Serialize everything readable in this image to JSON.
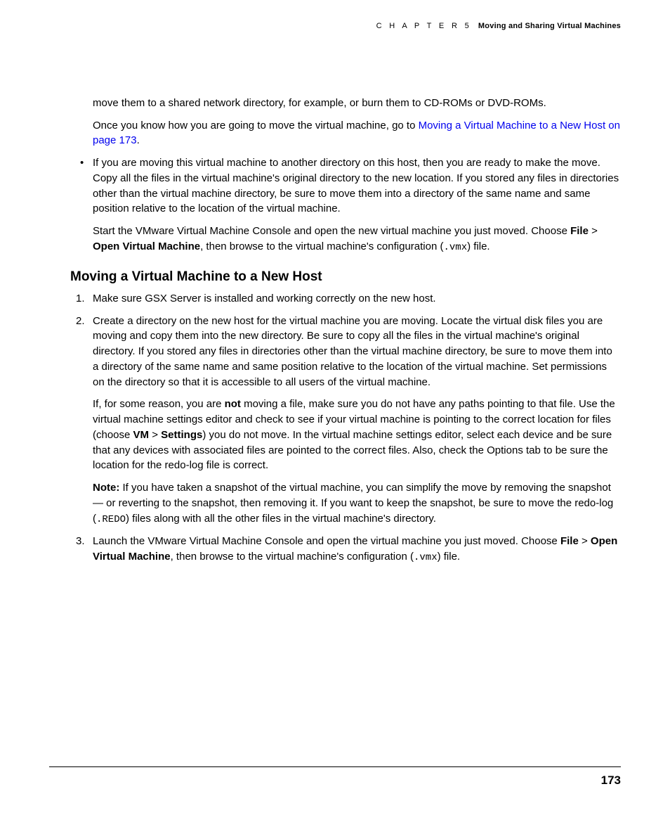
{
  "header": {
    "chapter_label": "C H A P T E R  5",
    "chapter_title": "Moving and Sharing Virtual Machines"
  },
  "intro": {
    "p1": "move them to a shared network directory, for example, or burn them to CD-ROMs or DVD-ROMs.",
    "p2a": "Once you know how you are going to move the virtual machine, go to ",
    "p2_link": "Moving a Virtual Machine to a New Host on page 173",
    "p2b": "."
  },
  "bullet1": {
    "p1": "If you are moving this virtual machine to another directory on this host, then you are ready to make the move. Copy all the files in the virtual machine's original directory to the new location. If you stored any files in directories other than the virtual machine directory, be sure to move them into a directory of the same name and same position relative to the location of the virtual machine.",
    "p2": {
      "t1": "Start the VMware Virtual Machine Console and open the new virtual machine you just moved. Choose ",
      "b1": "File",
      "t2": " > ",
      "b2": "Open Virtual Machine",
      "t3": ", then browse to the virtual machine's configuration (",
      "m1": ".vmx",
      "t4": ") file."
    }
  },
  "section_heading": "Moving a Virtual Machine to a New Host",
  "steps": {
    "s1": "Make sure GSX Server is installed and working correctly on the new host.",
    "s2": {
      "p1": "Create a directory on the new host for the virtual machine you are moving. Locate the virtual disk files you are moving and copy them into the new directory. Be sure to copy all the files in the virtual machine's original directory. If you stored any files in directories other than the virtual machine directory, be sure to move them into a directory of the same name and same position relative to the location of the virtual machine. Set permissions on the directory so that it is accessible to all users of the virtual machine.",
      "p2": {
        "t1": "If, for some reason, you are ",
        "b1": "not",
        "t2": " moving a file, make sure you do not have any paths pointing to that file. Use the virtual machine settings editor and check to see if your virtual machine is pointing to the correct location for files (choose ",
        "b2": "VM",
        "t3": " > ",
        "b3": "Settings",
        "t4": ") you do not move. In the virtual machine settings editor, select each device and be sure that any devices with associated files are pointed to the correct files. Also, check the Options tab to be sure the location for the redo-log file is correct."
      },
      "p3": {
        "b1": "Note:",
        "t1": "  If you have taken a snapshot of the virtual machine, you can simplify the move by removing the snapshot — or reverting to the snapshot, then removing it. If you want to keep the snapshot, be sure to move the redo-log (",
        "m1": ".REDO",
        "t2": ") files along with all the other files in the virtual machine's directory."
      }
    },
    "s3": {
      "t1": "Launch the VMware Virtual Machine Console and open the virtual machine you just moved. Choose ",
      "b1": "File",
      "t2": " > ",
      "b2": "Open Virtual Machine",
      "t3": ", then browse to the virtual machine's configuration (",
      "m1": ".vmx",
      "t4": ") file."
    }
  },
  "page_number": "173"
}
